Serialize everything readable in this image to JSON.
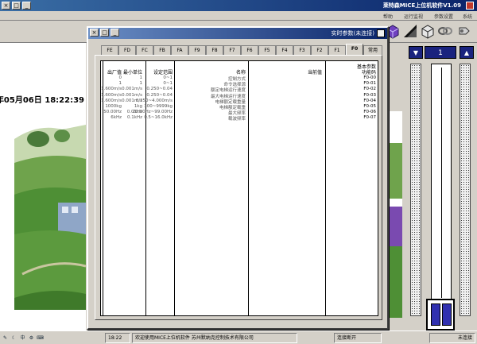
{
  "app": {
    "title": "莱特森MICE上位机软件V1.09",
    "menu": [
      "系统",
      "参数设置",
      "运行监视",
      "帮助"
    ],
    "datetime": "年05月06日 18:22:39"
  },
  "dialog": {
    "title": "实时参数(未连接)",
    "tabs": [
      "常用",
      "F0",
      "F1",
      "F2",
      "F3",
      "F4",
      "F5",
      "F6",
      "F7",
      "F8",
      "F9",
      "FA",
      "FB",
      "FC",
      "FD",
      "FE"
    ],
    "active_tab": "F0",
    "group_title": "基本参数",
    "columns": [
      "功能码",
      "当前值",
      "名称",
      "设定范围",
      "最小单位",
      "出厂值"
    ],
    "rows": [
      {
        "code": "F0-00",
        "current": "",
        "name": "控制方式",
        "range": "0~1",
        "unit": "1",
        "default": "0"
      },
      {
        "code": "F0-01",
        "current": "",
        "name": "命令选择源",
        "range": "0~1",
        "unit": "1",
        "default": "1"
      },
      {
        "code": "F0-02",
        "current": "",
        "name": "额定电梯运行速度",
        "range": "0.250~0.04",
        "unit": "0.001m/s",
        "default": "1.600m/s"
      },
      {
        "code": "F0-03",
        "current": "",
        "name": "最大电梯运行速度",
        "range": "0.250~0.04",
        "unit": "0.001m/s",
        "default": "1.600m/s"
      },
      {
        "code": "F0-04",
        "current": "",
        "name": "电梯额定载重量",
        "range": "0.250~4.000m/s",
        "unit": "0.001m/s",
        "default": "1.600m/s"
      },
      {
        "code": "F0-05",
        "current": "",
        "name": "电梯额定载重",
        "range": "300~9999kg",
        "unit": "1kg",
        "default": "1000kg"
      },
      {
        "code": "F0-06",
        "current": "",
        "name": "最大频率",
        "range": "20.00Hz~99.00Hz",
        "unit": "0.01Hz",
        "default": "50.00Hz"
      },
      {
        "code": "F0-07",
        "current": "",
        "name": "载波频率",
        "range": "0.5~16.0kHz",
        "unit": "0.1kHz",
        "default": "6kHz"
      }
    ]
  },
  "control_panel": {
    "channel": "1"
  },
  "statusbar": {
    "state": "未连接",
    "connection": "连接断开",
    "company": "欢迎使用MICE上位机软件   苏州默纳克控制技术有限公司",
    "time": "18:22"
  },
  "colors": {
    "titlebar": "#0a246a",
    "dialog_title": "#6a8ec5",
    "panel_blue": "#1a237e",
    "fader_bar": "#3030b0"
  }
}
